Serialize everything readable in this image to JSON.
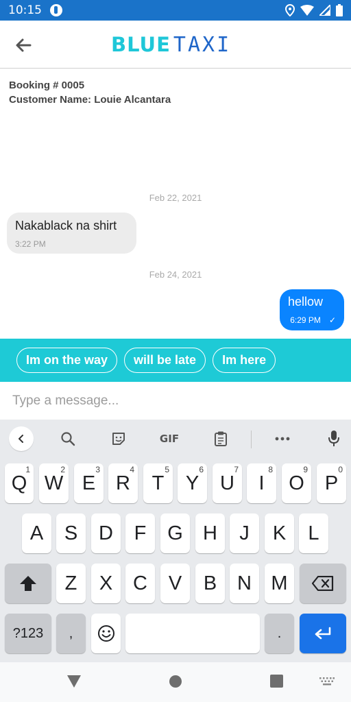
{
  "status_bar": {
    "time": "10:15"
  },
  "header": {
    "brand_blue": "BLUE",
    "brand_taxi": "TAXI"
  },
  "booking": {
    "booking_line": "Booking # 0005",
    "customer_line": "Customer Name: Louie Alcantara"
  },
  "messages": [
    {
      "date": "Feb 22, 2021",
      "text": "Nakablack na shirt",
      "time": "3:22 PM",
      "direction": "incoming"
    },
    {
      "date": "Feb 24, 2021",
      "text": "hellow",
      "time": "6:29 PM",
      "status": "✓",
      "direction": "outgoing"
    }
  ],
  "quick_replies": [
    "Im on the way",
    "will be late",
    "Im here"
  ],
  "composer": {
    "placeholder": "Type a message..."
  },
  "keyboard": {
    "gif_label": "GIF",
    "row1": [
      "Q",
      "W",
      "E",
      "R",
      "T",
      "Y",
      "U",
      "I",
      "O",
      "P"
    ],
    "row1_hints": [
      "1",
      "2",
      "3",
      "4",
      "5",
      "6",
      "7",
      "8",
      "9",
      "0"
    ],
    "row2": [
      "A",
      "S",
      "D",
      "F",
      "G",
      "H",
      "J",
      "K",
      "L"
    ],
    "row3": [
      "Z",
      "X",
      "C",
      "V",
      "B",
      "N",
      "M"
    ],
    "symbols_label": "?123",
    "comma": ",",
    "period": "."
  },
  "colors": {
    "status_bar": "#1a73c9",
    "brand_cyan": "#1fc7d8",
    "brand_blue": "#1f66c9",
    "outgoing_bubble": "#0a84ff",
    "quick_reply_bar": "#1ecad6",
    "enter_key": "#1a73e8"
  }
}
